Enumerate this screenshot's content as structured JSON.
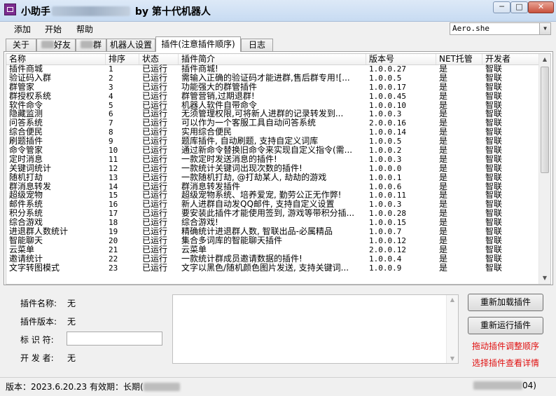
{
  "window": {
    "title_prefix": "小助手",
    "title_suffix": "by 第十代机器人",
    "buttons": {
      "minimize": "─",
      "maximize": "□",
      "close": "✕"
    }
  },
  "menu": {
    "items": [
      "添加",
      "开始",
      "帮助"
    ]
  },
  "account_select": {
    "value": "Aero.she"
  },
  "tabs": [
    {
      "label": "关于"
    },
    {
      "label": "好友"
    },
    {
      "label": "群"
    },
    {
      "label": "机器人设置"
    },
    {
      "label": "插件(注意插件顺序)"
    },
    {
      "label": "日志"
    }
  ],
  "table": {
    "columns": [
      "名称",
      "排序",
      "状态",
      "插件简介",
      "版本号",
      "NET托管",
      "开发者"
    ],
    "rows": [
      [
        "插件商城",
        "1",
        "已运行",
        "插件商城!",
        "1.0.0.27",
        "是",
        "智联"
      ],
      [
        "验证码入群",
        "2",
        "已运行",
        "需输入正确的验证码才能进群,售后群专用![...",
        "1.0.0.5",
        "是",
        "智联"
      ],
      [
        "群管家",
        "3",
        "已运行",
        "功能强大的群管插件",
        "1.0.0.17",
        "是",
        "智联"
      ],
      [
        "群授权系统",
        "4",
        "已运行",
        "群管营销,过期退群!",
        "1.0.0.45",
        "是",
        "智联"
      ],
      [
        "软件命令",
        "5",
        "已运行",
        "机器人软件自带命令",
        "1.0.0.10",
        "是",
        "智联"
      ],
      [
        "隐藏监测",
        "6",
        "已运行",
        "无须管理权限,可将新人进群的记录转发到...",
        "1.0.0.3",
        "是",
        "智联"
      ],
      [
        "问答系统",
        "7",
        "已运行",
        "可以作为一个客服工具自动问答系统",
        "2.0.0.16",
        "是",
        "智联"
      ],
      [
        "综合便民",
        "8",
        "已运行",
        "实用综合便民",
        "1.0.0.14",
        "是",
        "智联"
      ],
      [
        "刷题插件",
        "9",
        "已运行",
        "题库插件, 自动刷题, 支持自定义词库",
        "1.0.0.5",
        "是",
        "智联"
      ],
      [
        "命令管家",
        "10",
        "已运行",
        "通过新命令替换旧命令来实现自定义指令(需...",
        "1.0.0.2",
        "是",
        "智联"
      ],
      [
        "定时消息",
        "11",
        "已运行",
        "一款定时发送消息的插件!",
        "1.0.0.3",
        "是",
        "智联"
      ],
      [
        "关键词统计",
        "12",
        "已运行",
        "一款统计关键词出现次数的插件!",
        "1.0.0.0",
        "是",
        "智联"
      ],
      [
        "随机打劫",
        "13",
        "已运行",
        "一款随机打劫, @打劫某人, 劫劫的游戏",
        "1.0.0.1",
        "是",
        "智联"
      ],
      [
        "群消息转发",
        "14",
        "已运行",
        "群消息转发插件",
        "1.0.0.6",
        "是",
        "智联"
      ],
      [
        "超级宠物",
        "15",
        "已运行",
        "超级宠物系统、培养爱宠, 勤劳公正无作弊!",
        "1.0.0.11",
        "是",
        "智联"
      ],
      [
        "邮件系统",
        "16",
        "已运行",
        "新人进群自动发QQ邮件, 支持自定义设置",
        "1.0.0.3",
        "是",
        "智联"
      ],
      [
        "积分系统",
        "17",
        "已运行",
        "要安装此插件才能使用签到, 游戏等带积分插...",
        "1.0.0.28",
        "是",
        "智联"
      ],
      [
        "综合游戏",
        "18",
        "已运行",
        "综合游戏!",
        "1.0.0.15",
        "是",
        "智联"
      ],
      [
        "进退群人数统计",
        "19",
        "已运行",
        "精确统计进退群人数, 智联出品-必属精品",
        "1.0.0.7",
        "是",
        "智联"
      ],
      [
        "智能聊天",
        "20",
        "已运行",
        "集合多词库的智能聊天插件",
        "1.0.0.12",
        "是",
        "智联"
      ],
      [
        "云菜单",
        "21",
        "已运行",
        "云菜单",
        "2.0.0.12",
        "是",
        "智联"
      ],
      [
        "邀请统计",
        "22",
        "已运行",
        "一款统计群成员邀请数据的插件!",
        "1.0.0.4",
        "是",
        "智联"
      ],
      [
        "文字转图模式",
        "23",
        "已运行",
        "文字以黑色/随机颜色图片发送, 支持关键词...",
        "1.0.0.9",
        "是",
        "智联"
      ]
    ]
  },
  "details": {
    "name_label": "插件名称:",
    "name_value": "无",
    "version_label": "插件版本:",
    "version_value": "无",
    "id_label": "标 识 符:",
    "dev_label": "开 发 者:",
    "dev_value": "无"
  },
  "actions": {
    "reload": "重新加载插件",
    "rerun": "重新运行插件",
    "hint_drag": "拖动插件调整顺序",
    "hint_select": "选择插件查看详情"
  },
  "status": {
    "left": "版本：2023.6.20.23 有效期：长期(",
    "right": "04)"
  },
  "colors": {
    "hint": "#e01010",
    "titlebar": "#c7dbf2"
  }
}
